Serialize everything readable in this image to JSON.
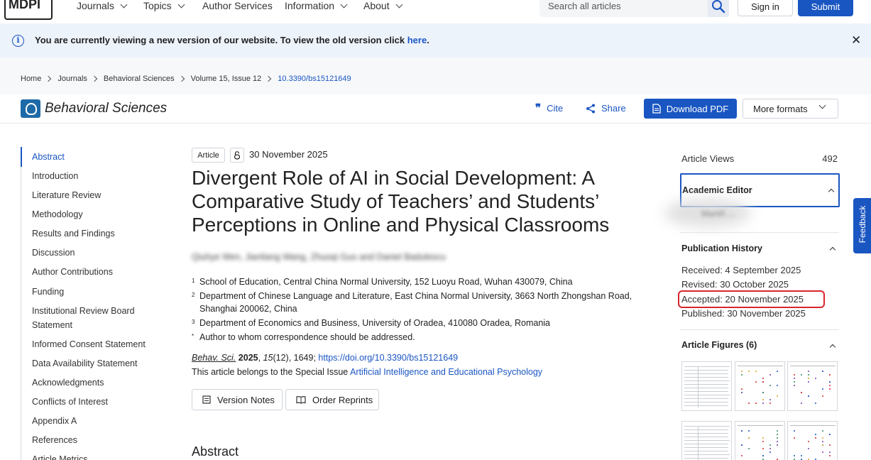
{
  "nav": {
    "logo": "MDPI",
    "items": [
      "Journals",
      "Topics",
      "Author Services",
      "Information",
      "About"
    ],
    "search_placeholder": "Search all articles",
    "sign_in": "Sign in",
    "submit": "Submit"
  },
  "banner": {
    "message": "You are currently viewing a new version of our website. To view the old version click",
    "link": "here",
    "tail": "."
  },
  "breadcrumb": [
    "Home",
    "Journals",
    "Behavioral Sciences",
    "Volume 15, Issue 12",
    "10.3390/bs15121649"
  ],
  "journal_bar": {
    "name": "Behavioral Sciences",
    "cite": "Cite",
    "share": "Share",
    "download_pdf": "Download PDF",
    "more_formats": "More formats"
  },
  "toc": [
    "Abstract",
    "Introduction",
    "Literature Review",
    "Methodology",
    "Results and Findings",
    "Discussion",
    "Author Contributions",
    "Funding",
    "Institutional Review Board Statement",
    "Informed Consent Statement",
    "Data Availability Statement",
    "Acknowledgments",
    "Conflicts of Interest",
    "Appendix A",
    "References",
    "Article Metrics"
  ],
  "article": {
    "type_tag": "Article",
    "open_access_symbol": "🔓",
    "date": "30 November 2025",
    "title": "Divergent Role of AI in Social Development: A Comparative Study of Teachers’ and Students’ Perceptions in Online and Physical Classrooms",
    "authors": "Qiuhye Wen, Jianliang Wang, Zhuoqi Guo and Daniel Badulescu",
    "affiliations": [
      {
        "num": "1",
        "text": "School of Education, Central China Normal University, 152 Luoyu Road, Wuhan 430079, China"
      },
      {
        "num": "2",
        "text": "Department of Chinese Language and Literature, East China Normal University, 3663 North Zhongshan Road, Shanghai 200062, China"
      },
      {
        "num": "3",
        "text": "Department of Economics and Business, University of Oradea, 410080 Oradea, Romania"
      },
      {
        "num": "*",
        "text": "Author to whom correspondence should be addressed."
      }
    ],
    "citation": {
      "journal": "Behav. Sci.",
      "year": "2025",
      "volume": "15",
      "issue_pages": "(12), 1649; ",
      "doi_link": "https://doi.org/10.3390/bs15121649"
    },
    "special_issue_prefix": "This article belongs to the Special Issue",
    "special_issue_link": "Artificial Intelligence and Educational Psychology",
    "version_notes": "Version Notes",
    "order_reprints": "Order Reprints",
    "abstract_heading": "Abstract"
  },
  "sidebar": {
    "views_label": "Article Views",
    "views_value": "492",
    "academic_editor": "Academic Editor",
    "editor_name": "Martiñ ...",
    "publication_history": "Publication History",
    "received": "Received: 4 September 2025",
    "revised": "Revised: 30 October 2025",
    "accepted": "Accepted: 20 November 2025",
    "published": "Published: 30 November 2025",
    "figures_heading": "Article Figures (6)"
  },
  "feedback": "Feedback",
  "colors": {
    "accent": "#1a56c2",
    "highlight": "#d8262d"
  }
}
